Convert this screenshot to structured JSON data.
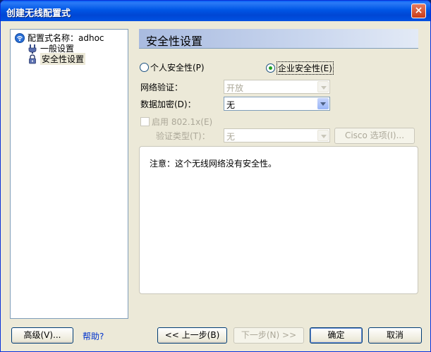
{
  "window": {
    "title": "创建无线配置式",
    "close_symbol": "×"
  },
  "sidebar": {
    "profile_label": "配置式名称：adhoc",
    "items": [
      {
        "label": "一般设置"
      },
      {
        "label": "安全性设置"
      }
    ]
  },
  "content": {
    "heading": "安全性设置",
    "personal_security": "个人安全性(P)",
    "enterprise_security": "企业安全性(E)",
    "selected_security": "企业安全性(E)",
    "network_auth_label": "网络验证：",
    "network_auth_value": "开放",
    "data_encryption_label": "数据加密(D)：",
    "data_encryption_value": "无",
    "enable_8021x_label": "启用 802.1x(E)",
    "auth_type_label": "验证类型(T)：",
    "auth_type_value": "无",
    "cisco_options_button": "Cisco 选项(I)...",
    "notice_text": "注意：这个无线网络没有安全性。"
  },
  "footer": {
    "advanced_button": "高级(V)...",
    "help_link": "帮助?",
    "back_button": "<< 上一步(B)",
    "next_button": "下一步(N) >>",
    "ok_button": "确定",
    "cancel_button": "取消"
  },
  "colors": {
    "title_bar": "#0054e3",
    "dialog_bg": "#ece9d8",
    "header_gradient_start": "#a9bbe0",
    "radio_dot": "#21a121",
    "link": "#0033cc"
  }
}
